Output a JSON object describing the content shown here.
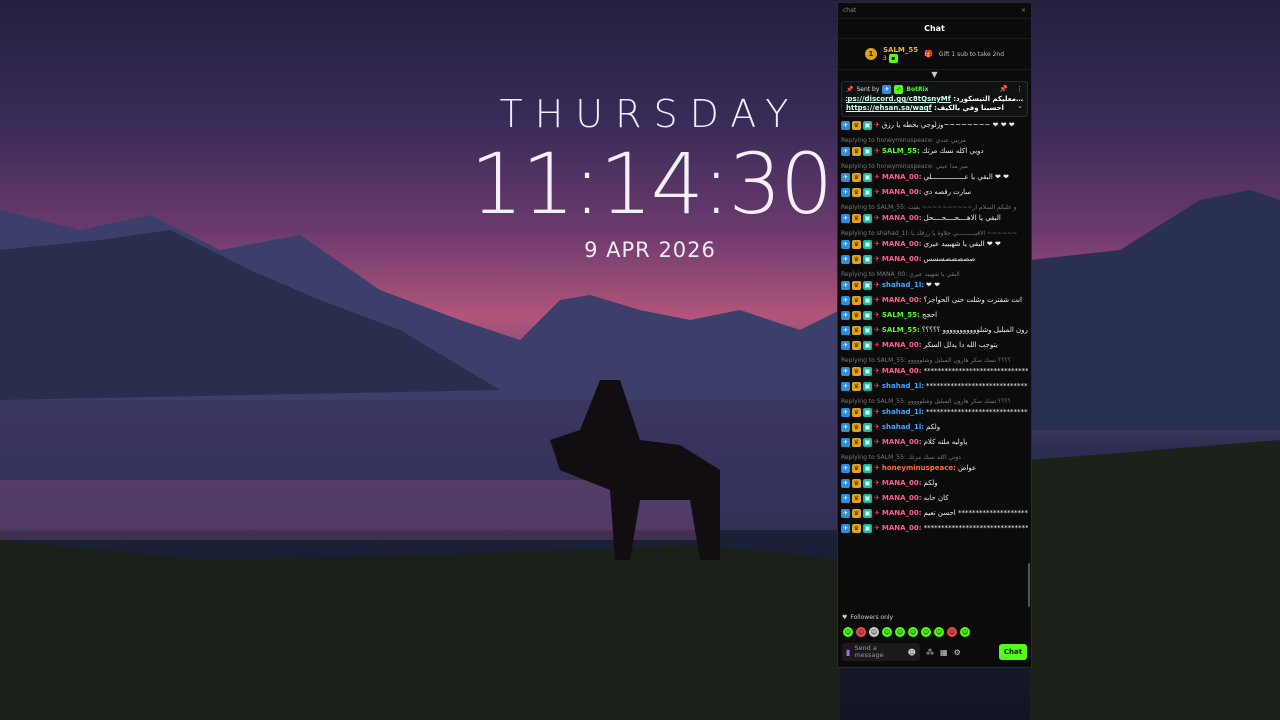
{
  "clock": {
    "day": "THURSDAY",
    "time": "11:14:30",
    "date": "9 APR 2026"
  },
  "window": {
    "title": "chat",
    "close": "×"
  },
  "chat": {
    "header": "Chat",
    "top_gifter": {
      "rank": "1",
      "name": "SALM_55",
      "count": "3"
    },
    "gift_hint": "Gift 1 sub to take 2nd",
    "pinned": {
      "sent_by_label": "Sent by",
      "sender": "BotRix",
      "line1_text": "…معليكم التيسكورد:",
      "line1_link": "https://discord.gg/c8tQsnyMf",
      "line2_text": "احسبنا وفي بالكيف:",
      "line2_link": "https://ehsan.sa/waqf"
    },
    "messages": [
      {
        "reply": "",
        "user": "",
        "text": "وزلوجي بحطه يا رزق~~~~~~~~ ❤ ❤ ❤"
      },
      {
        "reply": "Replying to honeyminuspeace: مزيبي عندي",
        "user": "SALM_55:",
        "cls": "u-salm",
        "text": "دوبي اكله نسك مرتك"
      },
      {
        "reply": "Replying to honeyminuspeace: مبر مدا عيني",
        "user": "MANA_00:",
        "cls": "u-mana",
        "text": "البقي يا عــــــــــــــــلي ❤ ❤"
      },
      {
        "reply": "",
        "user": "MANA_00:",
        "cls": "u-mana",
        "text": "سارت رقصه دي"
      },
      {
        "reply": "Replying to SALM_55: و عليكم السلام ار~~~~~~~~~~ بقيت",
        "user": "MANA_00:",
        "cls": "u-mana",
        "text": "البقي يا الاهــــحــــحــــحل"
      },
      {
        "reply": "Replying to shahad_1l: الاقيــــــــــي حلاوة يا رزقك يا ~~~~~~",
        "user": "MANA_00:",
        "cls": "u-mana",
        "text": "البقي يا شهيييد عيري ❤ ❤"
      },
      {
        "reply": "",
        "user": "MANA_00:",
        "cls": "u-mana",
        "text": "صصصصصسسس"
      },
      {
        "reply": "Replying to MANA_00: البقي يا شهييد عيري",
        "user": "shahad_1l:",
        "cls": "u-shahad",
        "text": "❤ ❤"
      },
      {
        "reply": "",
        "user": "MANA_00:",
        "cls": "u-mana",
        "text": "انت شفترت وشلت حتى الحواجز؟"
      },
      {
        "reply": "",
        "user": "SALM_55:",
        "cls": "u-salm",
        "text": "احجج"
      },
      {
        "reply": "",
        "user": "SALM_55:",
        "cls": "u-salm",
        "text": "نسك سكر هارون المبليل وشلووووووووووو ؟؟؟؟؟"
      },
      {
        "reply": "",
        "user": "MANA_00:",
        "cls": "u-mana",
        "text": "يتوجب الله دا يدلل السكر"
      },
      {
        "reply": "Replying to SALM_55: ؟؟؟؟ نسك سكر هارون المبليل وشلووووو",
        "user": "MANA_00:",
        "cls": "u-mana",
        "text": "************************************"
      },
      {
        "reply": "",
        "user": "shahad_1l:",
        "cls": "u-shahad",
        "text": "**********************************"
      },
      {
        "reply": "Replying to SALM_55: ؟؟؟؟ نسك سكر هارون المبليل وشلووووو",
        "user": "shahad_1l:",
        "cls": "u-shahad",
        "text": "************************************************"
      },
      {
        "reply": "",
        "user": "shahad_1l:",
        "cls": "u-shahad",
        "text": "ولكم"
      },
      {
        "reply": "",
        "user": "MANA_00:",
        "cls": "u-mana",
        "text": "ياوليه ملته كلام"
      },
      {
        "reply": "Replying to SALM_55: دوبي اكله نسك مرتك",
        "user": "honeyminuspeace:",
        "cls": "u-honey",
        "text": "عواض"
      },
      {
        "reply": "",
        "user": "MANA_00:",
        "cls": "u-mana",
        "text": "ولكم"
      },
      {
        "reply": "",
        "user": "MANA_00:",
        "cls": "u-mana",
        "text": "كان حابه"
      },
      {
        "reply": "",
        "user": "MANA_00:",
        "cls": "u-mana",
        "text": "احسن تعيم ***************************************"
      },
      {
        "reply": "",
        "user": "MANA_00:",
        "cls": "u-mana",
        "text": "*************************************************"
      }
    ],
    "followers_only": "Followers only",
    "input_placeholder": "Send a message",
    "send_button": "Chat"
  }
}
